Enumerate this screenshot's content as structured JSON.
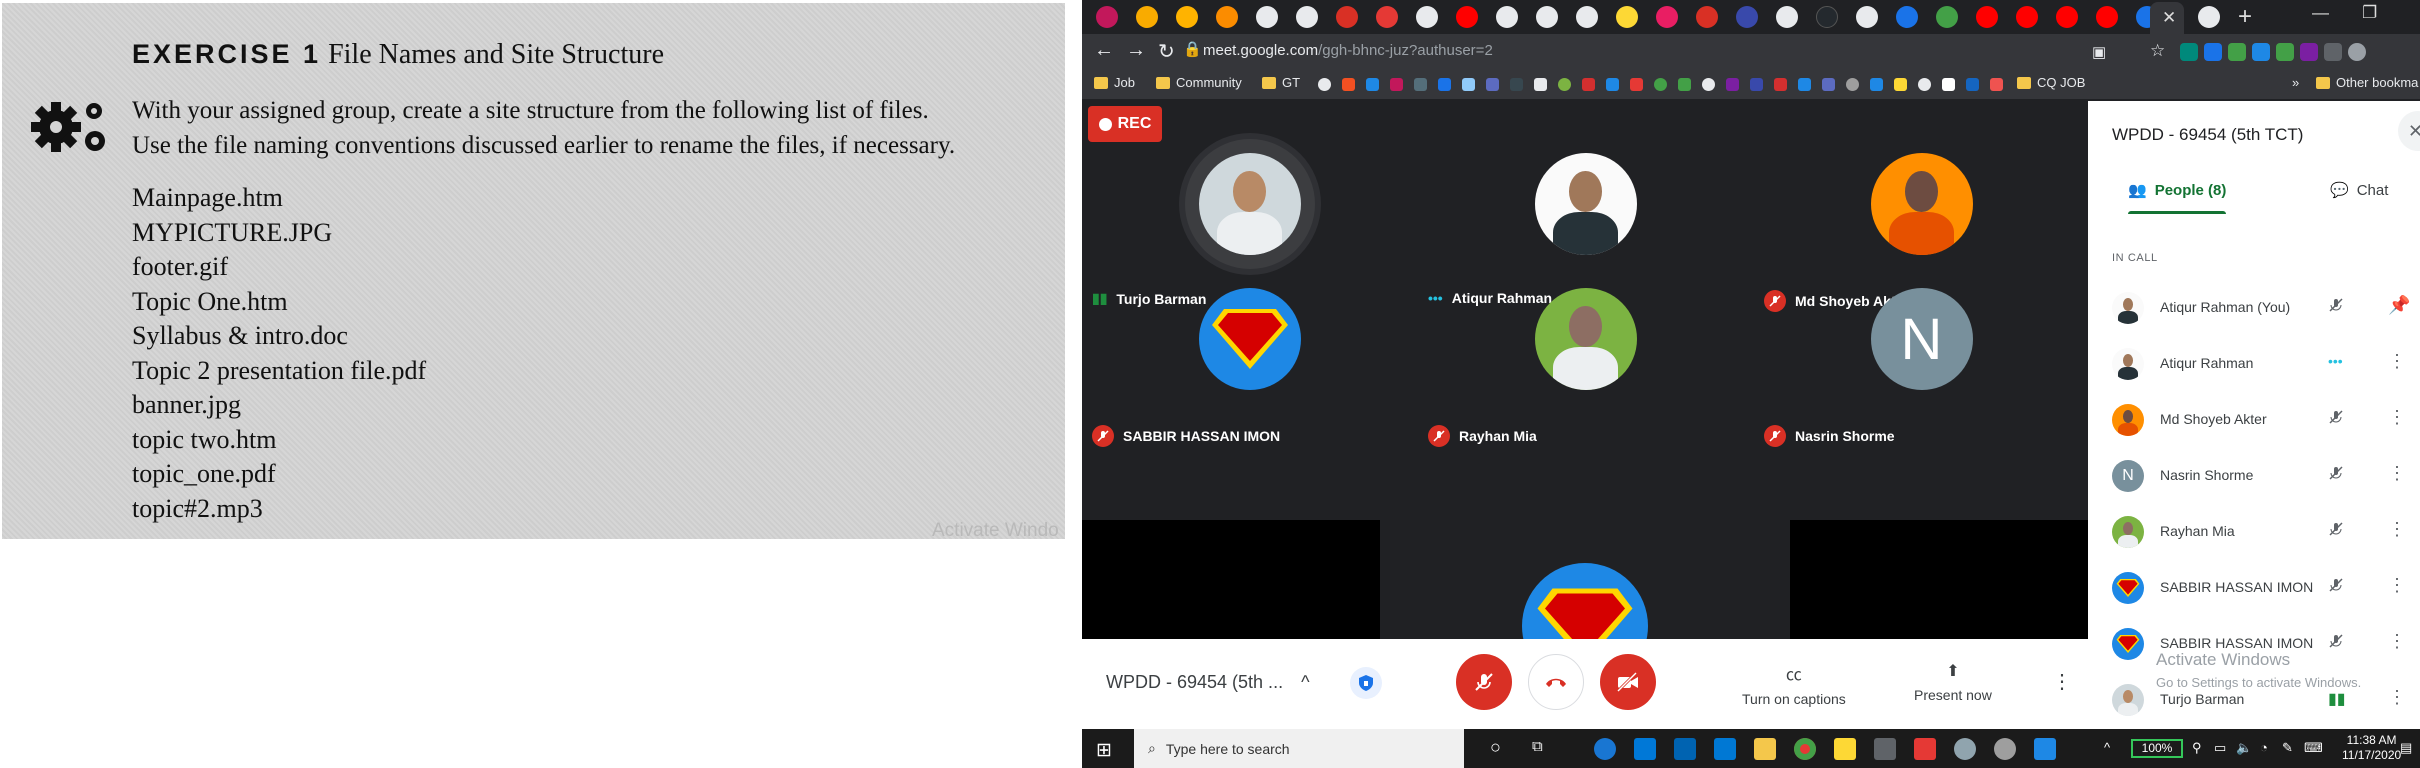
{
  "slide": {
    "exercise_label": "EXERCISE 1",
    "title": "File Names and Site Structure",
    "instructions": [
      "With your assigned group, create a site structure from the following list of files.",
      "Use the file naming conventions discussed earlier to rename the files, if necessary."
    ],
    "files": [
      "Mainpage.htm",
      "MYPICTURE.JPG",
      "footer.gif",
      "Topic One.htm",
      "Syllabus & intro.doc",
      "Topic 2 presentation file.pdf",
      "banner.jpg",
      "topic two.htm",
      "topic_one.pdf",
      "topic#2.mp3"
    ],
    "watermark": "Activate Windo"
  },
  "browser": {
    "url_host": "meet.google.com",
    "url_path": "/ggh-bhnc-juz?authuser=2",
    "bookmarks": [
      "Job",
      "Community",
      "GT",
      "CQ JOB"
    ],
    "other_bookmarks": "Other bookma"
  },
  "meet": {
    "rec_label": "REC",
    "participants_tiles": [
      {
        "name": "Turjo Barman",
        "status": "speaking"
      },
      {
        "name": "Atiqur Rahman",
        "status": "active"
      },
      {
        "name": "Md Shoyeb Akter",
        "status": "muted"
      },
      {
        "name": "SABBIR HASSAN IMON",
        "status": "muted"
      },
      {
        "name": "Rayhan Mia",
        "status": "muted"
      },
      {
        "name": "Nasrin Shorme",
        "status": "muted",
        "initial": "N"
      }
    ],
    "meeting_name": "WPDD - 69454 (5th ...",
    "turn_on_captions": "Turn on captions",
    "present_now": "Present now"
  },
  "panel": {
    "title": "WPDD - 69454 (5th TCT)",
    "people_tab": "People (8)",
    "chat_tab": "Chat",
    "in_call_label": "IN CALL",
    "people": [
      {
        "name": "Atiqur Rahman (You)",
        "mic": "muted",
        "action": "pin"
      },
      {
        "name": "Atiqur Rahman",
        "mic": "active",
        "action": "more"
      },
      {
        "name": "Md Shoyeb Akter",
        "mic": "muted",
        "action": "more"
      },
      {
        "name": "Nasrin Shorme",
        "mic": "muted",
        "action": "more",
        "initial": "N"
      },
      {
        "name": "Rayhan Mia",
        "mic": "muted",
        "action": "more"
      },
      {
        "name": "SABBIR HASSAN IMON",
        "mic": "muted",
        "action": "more"
      },
      {
        "name": "SABBIR HASSAN IMON",
        "mic": "muted",
        "action": "more"
      },
      {
        "name": "Turjo Barman",
        "mic": "speaking",
        "action": "more"
      }
    ],
    "activate_title": "Activate Windows",
    "activate_sub": "Go to Settings to activate Windows."
  },
  "taskbar": {
    "search_placeholder": "Type here to search",
    "battery": "100%",
    "time": "11:38 AM",
    "date": "11/17/2020"
  }
}
